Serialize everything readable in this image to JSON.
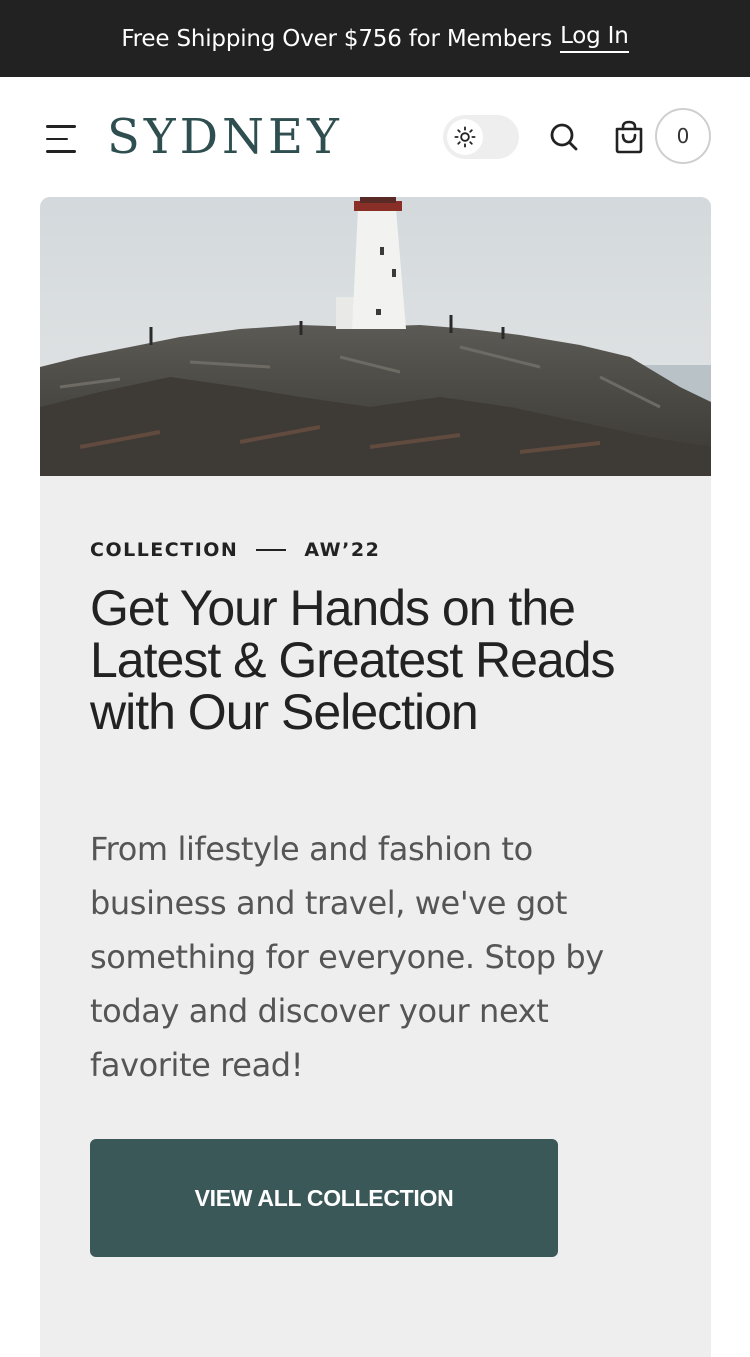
{
  "announcement": {
    "text": "Free Shipping Over $756 for Members",
    "login_label": "Log In"
  },
  "header": {
    "logo": "SYDNEY",
    "cart_count": "0",
    "icons": [
      "menu-icon",
      "sun-icon",
      "search-icon",
      "shopping-bag-icon"
    ]
  },
  "hero": {
    "image_alt": "lighthouse-on-rocky-coast-photo",
    "eyebrow_left": "COLLECTION",
    "eyebrow_right": "AW’22",
    "headline": "Get Your Hands on the Latest & Greatest Reads with Our Selection",
    "body": "From lifestyle and fashion to business and travel, we've got something for everyone. Stop by today and discover your next favorite read!",
    "cta_label": "VIEW ALL COLLECTION"
  },
  "colors": {
    "announcement_bg": "#222222",
    "brand": "#2e4e4f",
    "cta_bg": "#3b5859",
    "card_bg": "#eeeeee"
  }
}
